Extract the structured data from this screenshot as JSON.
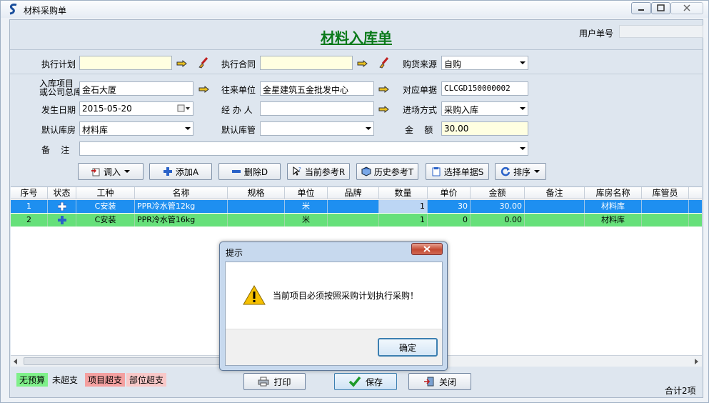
{
  "window": {
    "title": "材料采购单"
  },
  "header": {
    "doc_title": "材料入库单",
    "user_no_label": "用户单号",
    "user_no_value": ""
  },
  "form": {
    "exec_plan": {
      "label": "执行计划",
      "value": ""
    },
    "exec_contract": {
      "label": "执行合同",
      "value": ""
    },
    "purchase_source": {
      "label": "购货来源",
      "value": "自购"
    },
    "project": {
      "label_line1": "入库项目",
      "label_line2": "或公司总库",
      "value": "金石大厦"
    },
    "supplier": {
      "label": "往来单位",
      "value": "金星建筑五金批发中心"
    },
    "ref_doc": {
      "label": "对应单据",
      "value": "CLCGD150000002"
    },
    "date": {
      "label": "发生日期",
      "value": "2015-05-20"
    },
    "handler": {
      "label": "经 办 人",
      "value": ""
    },
    "entry_mode": {
      "label": "进场方式",
      "value": "采购入库"
    },
    "warehouse": {
      "label": "默认库房",
      "value": "材料库"
    },
    "keeper": {
      "label": "默认库管",
      "value": ""
    },
    "amount": {
      "label": "金    额",
      "value": "30.00"
    },
    "remark": {
      "label": "备    注",
      "value": ""
    }
  },
  "toolbar": {
    "import": "调入",
    "add": "添加A",
    "delete": "删除D",
    "current_ref": "当前参考R",
    "history_ref": "历史参考T",
    "select_doc": "选择单据S",
    "sort": "排序"
  },
  "grid": {
    "columns": [
      "序号",
      "状态",
      "工种",
      "名称",
      "规格",
      "单位",
      "品牌",
      "数量",
      "单价",
      "金额",
      "备注",
      "库房名称",
      "库管员"
    ],
    "rows": [
      {
        "no": "1",
        "trade": "C安装",
        "name": "PPR冷水管12kg",
        "spec": "",
        "unit": "米",
        "brand": "",
        "qty": "1",
        "price": "30",
        "amount": "30.00",
        "remark": "",
        "warehouse": "材料库",
        "keeper": ""
      },
      {
        "no": "2",
        "trade": "C安装",
        "name": "PPR冷水管16kg",
        "spec": "",
        "unit": "米",
        "brand": "",
        "qty": "1",
        "price": "0",
        "amount": "0.00",
        "remark": "",
        "warehouse": "材料库",
        "keeper": ""
      }
    ]
  },
  "legend": {
    "no_budget": "无预算",
    "not_over": "未超支",
    "project_over": "项目超支",
    "part_over": "部位超支"
  },
  "bottom": {
    "print": "打印",
    "save": "保存",
    "close": "关闭",
    "total": "合计2项"
  },
  "dialog": {
    "title": "提示",
    "message": "当前项目必须按照采购计划执行采购！",
    "ok": "确定"
  },
  "colors": {
    "title_green": "#0a7a1a",
    "row_selected": "#1e8ff0",
    "row_green": "#66e07a",
    "legend_green": "#7ff08a",
    "legend_red": "#f4a0a0",
    "legend_pink": "#f8c8c8"
  }
}
